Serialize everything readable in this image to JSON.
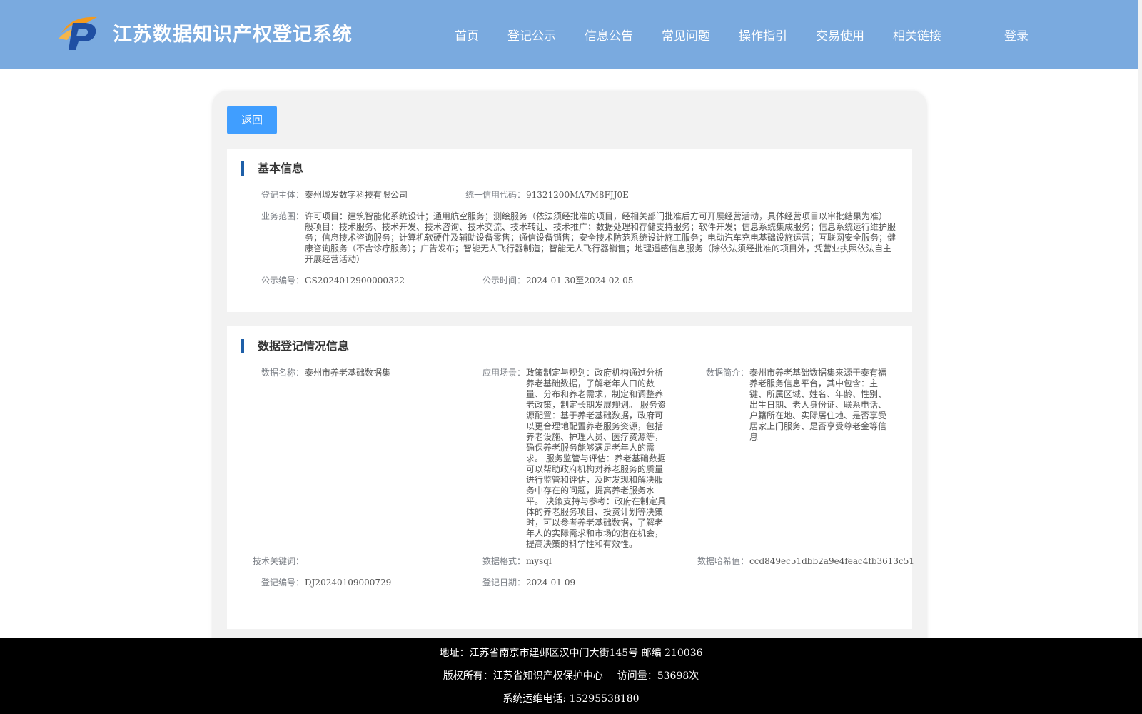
{
  "header": {
    "system_title": "江苏数据知识产权登记系统",
    "nav": [
      "首页",
      "登记公示",
      "信息公告",
      "常见问题",
      "操作指引",
      "交易使用",
      "相关链接"
    ],
    "login": "登录",
    "logo_colors": {
      "blue": "#1f4fa3",
      "orange": "#f39a1e"
    },
    "bg_color": "#7aaadf"
  },
  "back_button": "返回",
  "basic_info": {
    "title": "基本信息",
    "subject_label": "登记主体：",
    "subject_value": "泰州城发数字科技有限公司",
    "credit_label": "统一信用代码：",
    "credit_value": "91321200MA7M8FJJ0E",
    "scope_label": "业务范围：",
    "scope_value": "许可项目：建筑智能化系统设计；通用航空服务；测绘服务（依法须经批准的项目，经相关部门批准后方可开展经营活动，具体经营项目以审批结果为准） 一般项目：技术服务、技术开发、技术咨询、技术交流、技术转让、技术推广；数据处理和存储支持服务；软件开发；信息系统集成服务；信息系统运行维护服务；信息技术咨询服务；计算机软硬件及辅助设备零售；通信设备销售；安全技术防范系统设计施工服务；电动汽车充电基础设施运营；互联网安全服务；健康咨询服务（不含诊疗服务）；广告发布；智能无人飞行器制造；智能无人飞行器销售；地理遥感信息服务（除依法须经批准的项目外，凭营业执照依法自主开展经营活动）",
    "pub_no_label": "公示编号：",
    "pub_no_value": "GS2024012900000322",
    "pub_time_label": "公示时间：",
    "pub_time_value": "2024-01-30至2024-02-05"
  },
  "data_info": {
    "title": "数据登记情况信息",
    "name_label": "数据名称：",
    "name_value": "泰州市养老基础数据集",
    "scene_label": "应用场景：",
    "scene_value": "政策制定与规划：政府机构通过分析养老基础数据，了解老年人口的数量、分布和养老需求，制定和调整养老政策，制定长期发展规划。 服务资源配置：基于养老基础数据，政府可以更合理地配置养老服务资源，包括养老设施、护理人员、医疗资源等，确保养老服务能够满足老年人的需求。 服务监管与评估：养老基础数据可以帮助政府机构对养老服务的质量进行监管和评估，及时发现和解决服务中存在的问题，提高养老服务水平。 决策支持与参考：政府在制定具体的养老服务项目、投资计划等决策时，可以参考养老基础数据，了解老年人的实际需求和市场的潜在机会，提高决策的科学性和有效性。",
    "intro_label": "数据简介：",
    "intro_value": "泰州市养老基础数据集来源于泰有福养老服务信息平台，其中包含：主键、所属区域、姓名、年龄、性别、出生日期、老人身份证、联系电话、户籍所在地、实际居住地、是否享受居家上门服务、是否享受尊老金等信息",
    "keyword_label": "技术关键词：",
    "keyword_value": "",
    "format_label": "数据格式：",
    "format_value": "mysql",
    "hash_label": "数据哈希值：",
    "hash_value": "ccd849ec51dbb2a9e4feac4fb3613c51",
    "reg_no_label": "登记编号：",
    "reg_no_value": "DJ20240109000729",
    "reg_date_label": "登记日期：",
    "reg_date_value": "2024-01-09"
  },
  "footer": {
    "address": "地址：江苏省南京市建邺区汉中门大街145号 邮编 210036",
    "copyright": "版权所有：江苏省知识产权保护中心",
    "visits": "访问量：53698次",
    "phone": "系统运维电话: 15295538180"
  }
}
